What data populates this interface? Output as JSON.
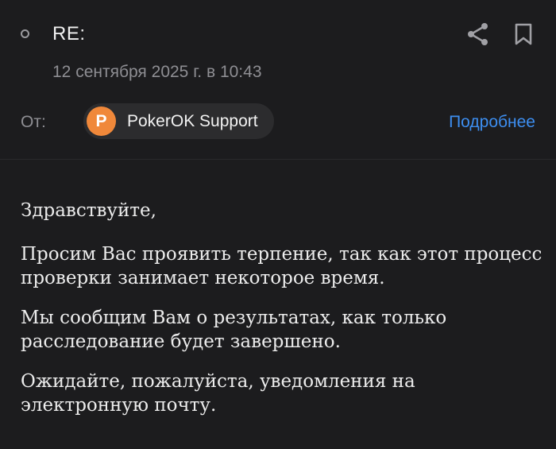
{
  "header": {
    "subject": "RE:",
    "date": "12 сентября 2025 г. в 10:43",
    "from_label": "От:",
    "sender": {
      "avatar_letter": "P",
      "avatar_color": "#f0883a",
      "name": "PokerOK Support"
    },
    "details_link": "Подробнее",
    "actions": {
      "share_icon": "share-icon",
      "bookmark_icon": "bookmark-icon"
    }
  },
  "body": {
    "greeting": "Здравствуйте,",
    "paragraphs": [
      "Просим Вас проявить терпение, так как этот процесс проверки занимает некоторое время.",
      "Мы сообщим Вам о результатах, как только расследование будет завершено.",
      "Ожидайте, пожалуйста, уведомления на электронную почту."
    ]
  },
  "colors": {
    "background": "#1c1c1e",
    "accent_link": "#3d8ef0",
    "secondary_text": "#8e8e93"
  }
}
